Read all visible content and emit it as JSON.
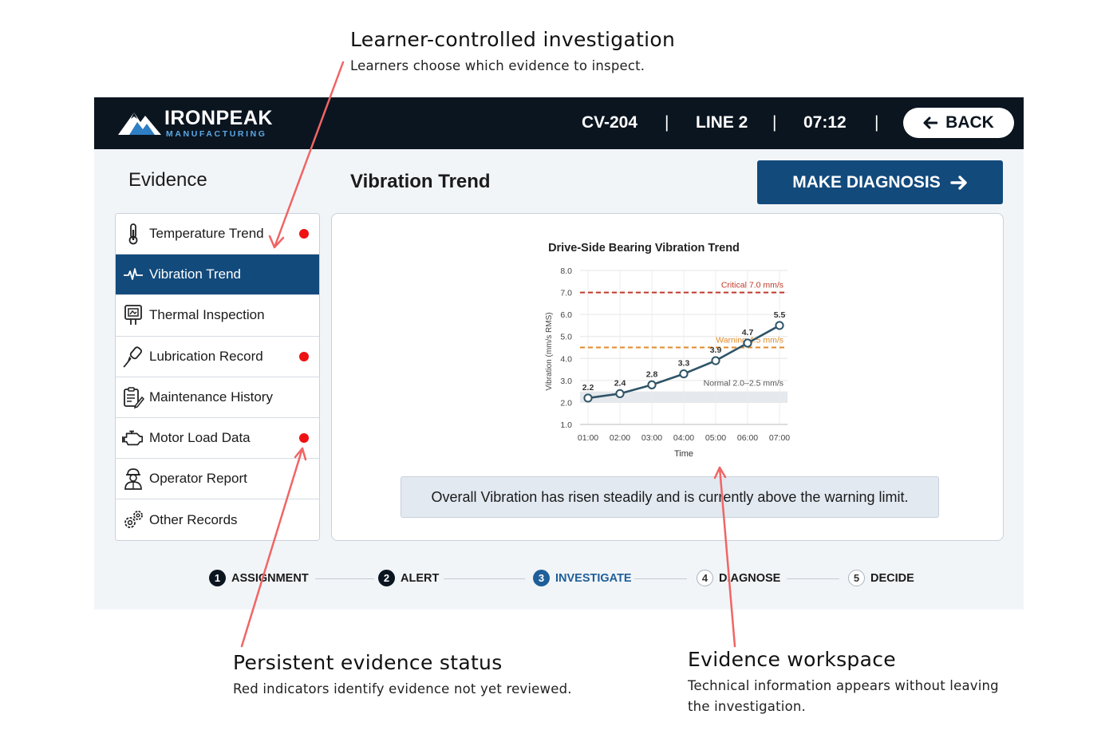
{
  "callouts": {
    "top": {
      "title": "Learner-controlled investigation",
      "sub": "Learners choose which evidence to inspect."
    },
    "bottom_left": {
      "title": "Persistent evidence status",
      "sub": "Red indicators identify evidence not yet reviewed."
    },
    "bottom_right": {
      "title": "Evidence workspace",
      "sub": "Technical information appears without leaving the investigation."
    }
  },
  "header": {
    "brand_name": "IRONPEAK",
    "brand_sub": "MANUFACTURING",
    "asset": "CV-204",
    "line": "LINE 2",
    "time": "07:12",
    "separator": "|",
    "back_label": "BACK"
  },
  "evidence_heading": "Evidence",
  "panel_title": "Vibration Trend",
  "diagnose_label": "MAKE DIAGNOSIS",
  "evidence_items": [
    {
      "label": "Temperature Trend",
      "icon": "thermometer-icon",
      "unreviewed": true
    },
    {
      "label": "Vibration Trend",
      "icon": "waveform-icon",
      "unreviewed": false,
      "active": true
    },
    {
      "label": "Thermal Inspection",
      "icon": "thermal-camera-icon",
      "unreviewed": false
    },
    {
      "label": "Lubrication Record",
      "icon": "grease-gun-icon",
      "unreviewed": true
    },
    {
      "label": "Maintenance History",
      "icon": "clipboard-icon",
      "unreviewed": false
    },
    {
      "label": "Motor Load Data",
      "icon": "engine-icon",
      "unreviewed": true
    },
    {
      "label": "Operator Report",
      "icon": "worker-icon",
      "unreviewed": false
    },
    {
      "label": "Other Records",
      "icon": "gears-icon",
      "unreviewed": false
    }
  ],
  "chart_data": {
    "type": "line",
    "title": "Drive-Side Bearing Vibration Trend",
    "xlabel": "Time",
    "ylabel": "Vibration (mm/s RMS)",
    "categories": [
      "01:00",
      "02:00",
      "03:00",
      "04:00",
      "05:00",
      "06:00",
      "07:00"
    ],
    "values": [
      2.2,
      2.4,
      2.8,
      3.3,
      3.9,
      4.7,
      5.5
    ],
    "value_labels": [
      "2.2",
      "2.4",
      "2.8",
      "3.3",
      "3.9",
      "4.7",
      "5.5"
    ],
    "ylim": [
      1.0,
      8.0
    ],
    "yticks": [
      "1.0",
      "2.0",
      "3.0",
      "4.0",
      "5.0",
      "6.0",
      "7.0",
      "8.0"
    ],
    "grid": true,
    "line_color": "#2f5468",
    "thresholds": [
      {
        "label": "Critical 7.0 mm/s",
        "value": 7.0,
        "color": "#c0392b"
      },
      {
        "label": "Warning 4.5 mm/s",
        "value": 4.5,
        "color": "#e08a2b"
      }
    ],
    "normal_band": {
      "label": "Normal 2.0–2.5 mm/s",
      "range": [
        2.0,
        2.5
      ],
      "color": "#e5e8ec"
    }
  },
  "summary": "Overall Vibration has risen steadily and is currently above the warning limit.",
  "steps": [
    {
      "num": "1",
      "label": "ASSIGNMENT",
      "state": "done"
    },
    {
      "num": "2",
      "label": "ALERT",
      "state": "done"
    },
    {
      "num": "3",
      "label": "INVESTIGATE",
      "state": "current"
    },
    {
      "num": "4",
      "label": "DIAGNOSE",
      "state": "todo"
    },
    {
      "num": "5",
      "label": "DECIDE",
      "state": "todo"
    }
  ],
  "colors": {
    "nav": "#0b1520",
    "accent": "#134a7c",
    "alert_dot": "#ee1111",
    "annotation_arrow": "#f06565"
  }
}
